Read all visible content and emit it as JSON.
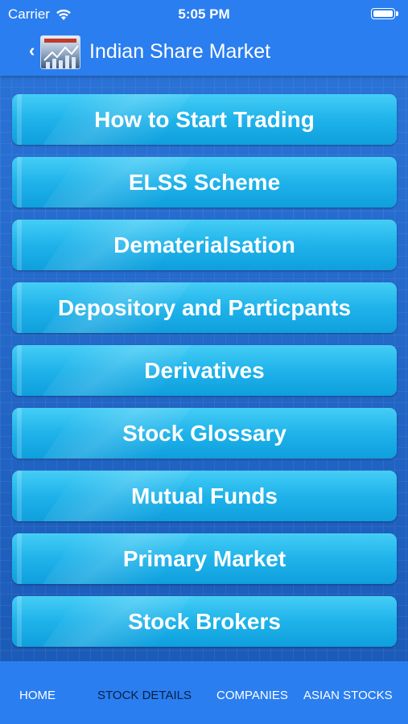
{
  "status_bar": {
    "carrier": "Carrier",
    "time": "5:05 PM"
  },
  "nav_bar": {
    "back_icon": "chevron-left-icon",
    "logo_icon": "indian-share-market-logo",
    "title": "Indian Share Market"
  },
  "menu": {
    "items": [
      {
        "label": "How to Start Trading"
      },
      {
        "label": "ELSS Scheme"
      },
      {
        "label": "Dematerialsation"
      },
      {
        "label": "Depository and Particpants"
      },
      {
        "label": "Derivatives"
      },
      {
        "label": "Stock Glossary"
      },
      {
        "label": "Mutual Funds"
      },
      {
        "label": "Primary Market"
      },
      {
        "label": "Stock Brokers"
      }
    ]
  },
  "tab_bar": {
    "tabs": [
      {
        "label": "HOME"
      },
      {
        "label": "STOCK DETAILS",
        "active": true
      },
      {
        "label": "COMPANIES"
      },
      {
        "label": "ASIAN STOCKS"
      }
    ]
  },
  "colors": {
    "bar_blue": "#2a7ef0",
    "button_cyan": "#1fb3ea",
    "background_blue": "#1f64c6",
    "active_tab": "#0a1f44"
  }
}
